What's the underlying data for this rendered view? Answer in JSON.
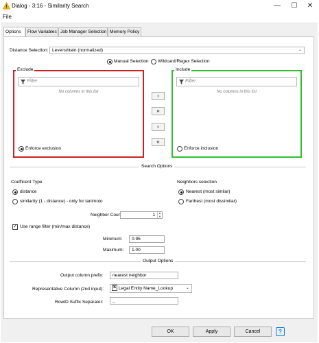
{
  "window": {
    "title": "Dialog - 3:16 - Similarity Search",
    "minimize": "—",
    "maximize": "☐",
    "close": "✕"
  },
  "menu": {
    "file": "File"
  },
  "tabs": [
    {
      "label": "Options"
    },
    {
      "label": "Flow Variables"
    },
    {
      "label": "Job Manager Selection"
    },
    {
      "label": "Memory Policy"
    }
  ],
  "distance": {
    "label": "Distance Selection:",
    "value": "Levenshtein (normalized)",
    "arrow": "⌄"
  },
  "selection_mode": {
    "manual": "Manual Selection",
    "wildcard": "Wildcard/Regex Selection"
  },
  "exclude": {
    "title": "Exclude",
    "filter_placeholder": "Filter",
    "empty": "No columns in this list",
    "enforce": "Enforce exclusion"
  },
  "include": {
    "title": "Include",
    "filter_placeholder": "Filter",
    "empty": "No columns in this list",
    "enforce": "Enforce inclusion"
  },
  "move_buttons": {
    "add": "›",
    "add_all": "»",
    "remove": "‹",
    "remove_all": "«"
  },
  "search_options": {
    "heading": "Search Options",
    "coefficient_label": "Coefficent Type",
    "distance": "distance",
    "similarity": "similarity (1 - distance) - only for tanimoto",
    "neighbors_label": "Neighbors selection",
    "nearest": "Nearest (most similar)",
    "farthest": "Farthest (most dissimilar)",
    "neighbor_count_label": "Neighbor Count:",
    "neighbor_count": "1",
    "range_filter": "Use range filter (min/max distance)",
    "minimum_label": "Minimum:",
    "minimum": "0.95",
    "maximum_label": "Maximum:",
    "maximum": "1.00"
  },
  "output_options": {
    "heading": "Output Options",
    "prefix_label": "Output column prefix:",
    "prefix": "nearest neighbor",
    "rep_column_label": "Representative Column (2nd input):",
    "rep_column_type": "S",
    "rep_column": "Legal Entity Name_Lookup",
    "arrow": "⌄",
    "rowid_label": "RowID Suffix Separator:",
    "rowid": "_"
  },
  "buttons": {
    "ok": "OK",
    "apply": "Apply",
    "cancel": "Cancel",
    "help": "?"
  },
  "colors": {
    "exclude_border": "#cc1f1f",
    "include_border": "#2ec02e",
    "help_blue": "#1979ca"
  }
}
